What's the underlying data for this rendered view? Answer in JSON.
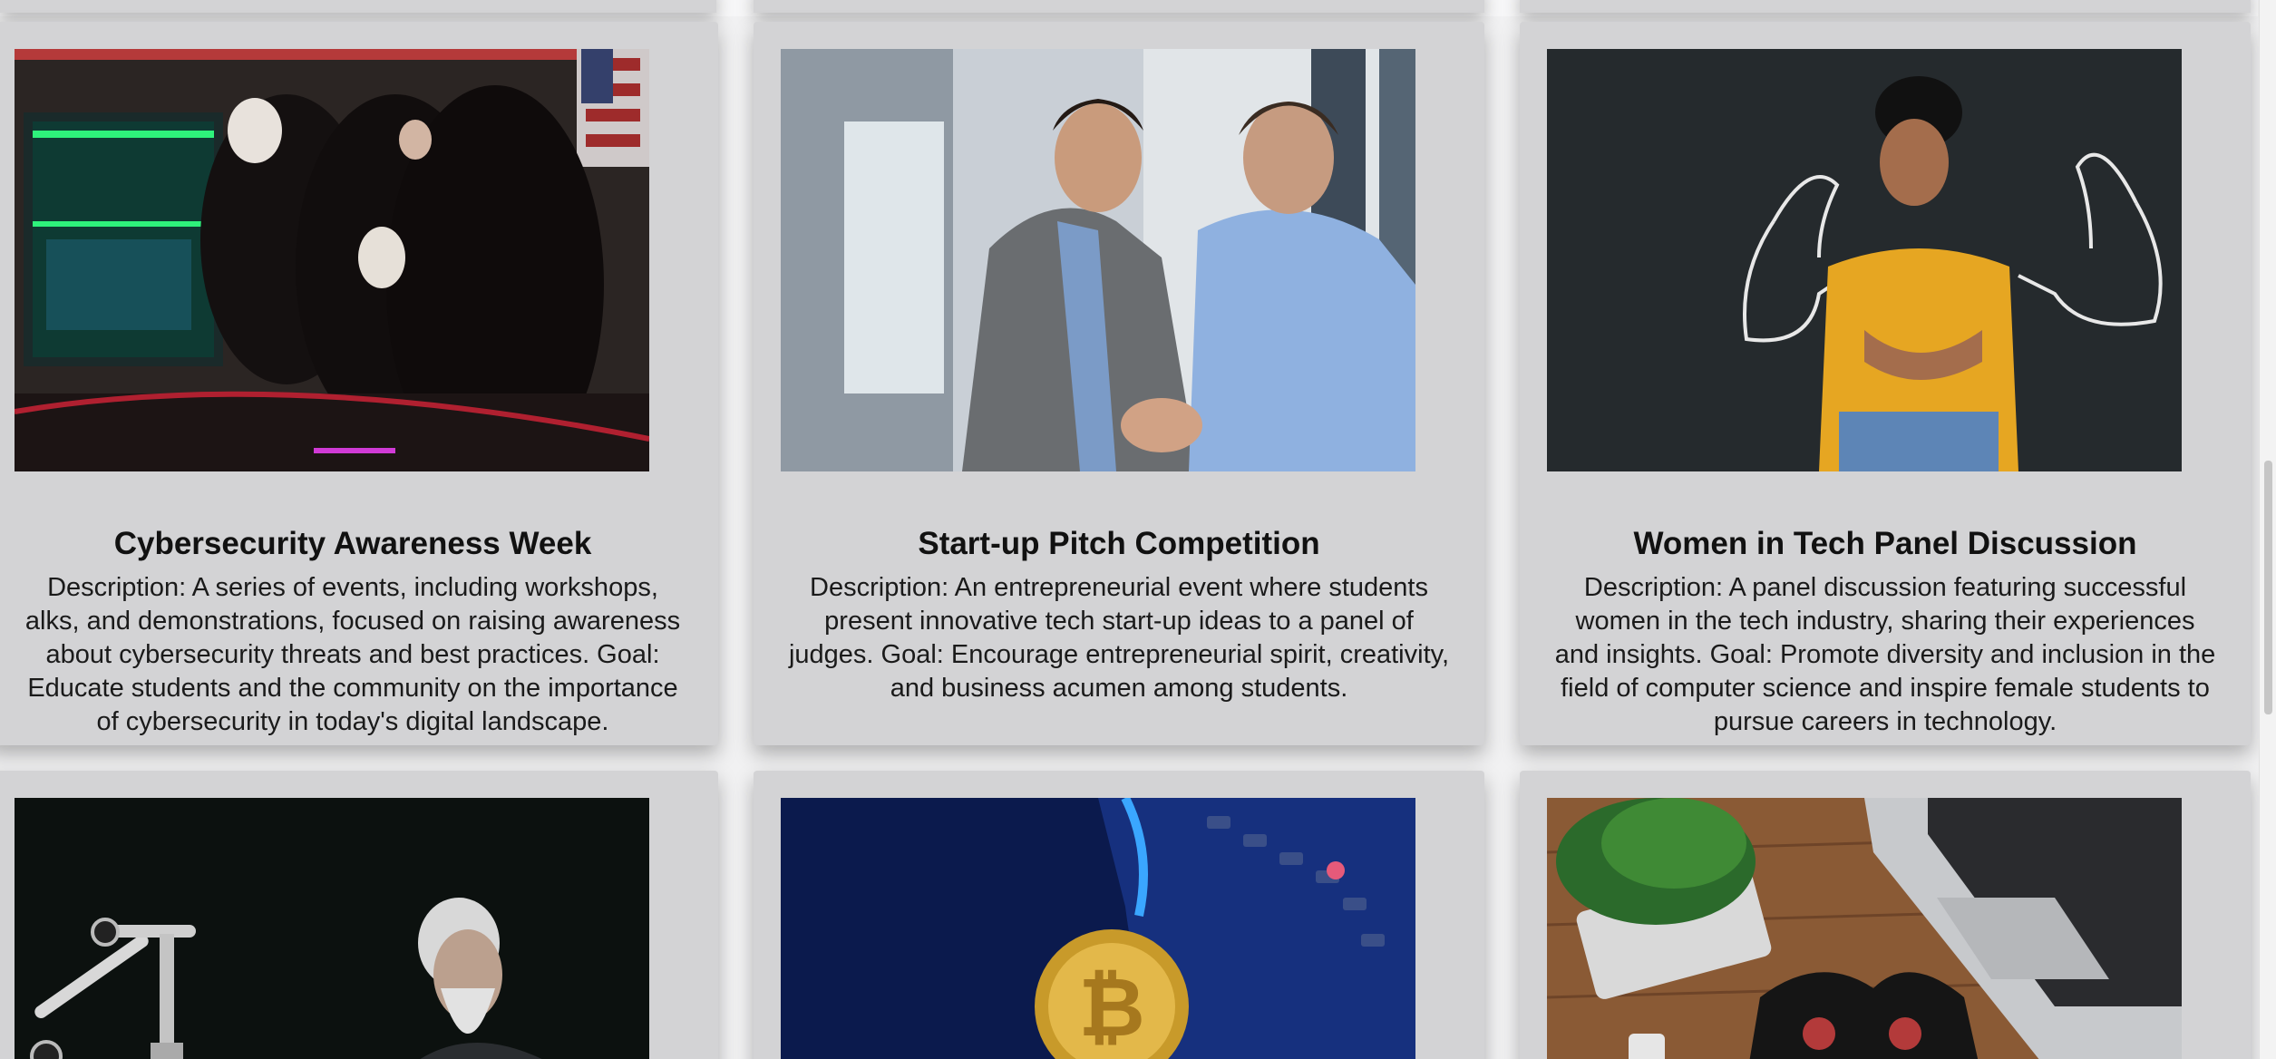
{
  "cards": [
    {
      "title": "Cybersecurity Awareness Week",
      "image": "hooded-hackers-computer-photo",
      "lines": [
        "Description: A series of events, including workshops,",
        "alks, and demonstrations, focused on raising awareness",
        "about cybersecurity threats and best practices. Goal:",
        "Educate students and the community on the importance",
        "of cybersecurity in today's digital landscape."
      ]
    },
    {
      "title": "Start-up Pitch Competition",
      "image": "business-handshake-photo",
      "lines": [
        "Description: An entrepreneurial event where students",
        "present innovative tech start-up ideas to a panel of",
        "judges. Goal: Encourage entrepreneurial spirit, creativity,",
        "and business acumen among students."
      ]
    },
    {
      "title": "Women in Tech Panel Discussion",
      "image": "woman-chalk-muscles-photo",
      "lines": [
        "Description: A panel discussion featuring successful",
        "women in the tech industry, sharing their experiences",
        "and insights. Goal: Promote diversity and inclusion in the",
        "field of computer science and inspire female students to",
        "pursue careers in technology."
      ]
    },
    {
      "image": "robot-arm-chess-photo"
    },
    {
      "image": "bitcoin-coin-photo"
    },
    {
      "image": "game-controller-laptop-photo"
    }
  ]
}
